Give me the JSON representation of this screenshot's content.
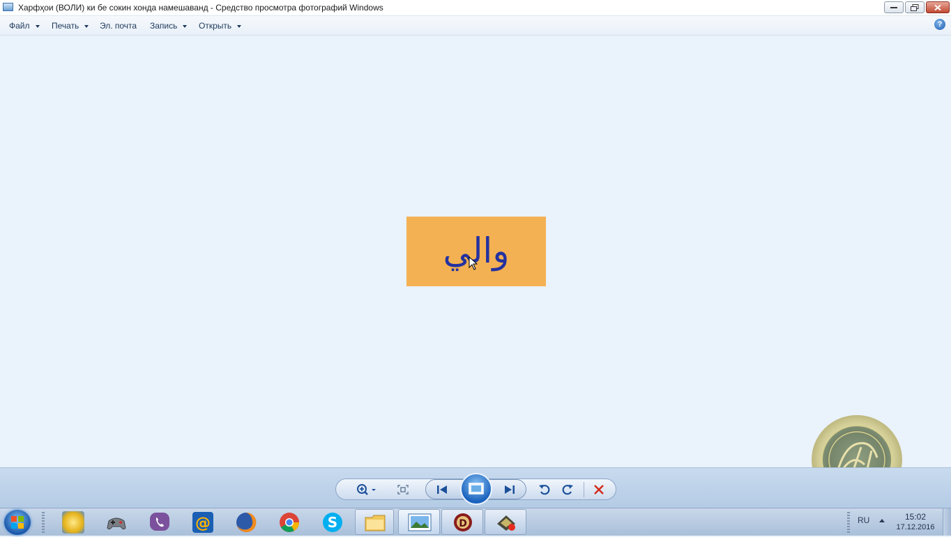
{
  "window": {
    "title": "Харфҳои (ВОЛИ) ки  бе сокин хонда намешаванд - Средство просмотра фотографий Windows"
  },
  "menu": {
    "items": [
      {
        "label": "Файл",
        "has_dropdown": true
      },
      {
        "label": "Печать",
        "has_dropdown": true
      },
      {
        "label": "Эл. почта",
        "has_dropdown": false
      },
      {
        "label": "Запись",
        "has_dropdown": true
      },
      {
        "label": "Открыть",
        "has_dropdown": true
      }
    ],
    "help_label": "?"
  },
  "photo": {
    "text": "والي",
    "background": "#f4b153",
    "text_color": "#2432a0"
  },
  "controls": {
    "buttons": [
      "zoom-icon",
      "actual-size-icon",
      "previous-icon",
      "slideshow-icon",
      "next-icon",
      "rotate-left-icon",
      "rotate-right-icon",
      "delete-icon"
    ]
  },
  "taskbar": {
    "pinned": [
      "media-center-icon",
      "games-icon",
      "viber-icon",
      "mail-icon",
      "firefox-icon",
      "chrome-icon",
      "skype-icon",
      "explorer-icon",
      "photo-viewer-icon",
      "app-icon",
      "recorder-icon"
    ],
    "tray": {
      "language": "RU",
      "time": "15:02",
      "date": "17.12.2016"
    }
  },
  "colors": {
    "accent": "#1a62bd",
    "canvas": "#eaf2fb",
    "close_button": "#c24a33"
  }
}
